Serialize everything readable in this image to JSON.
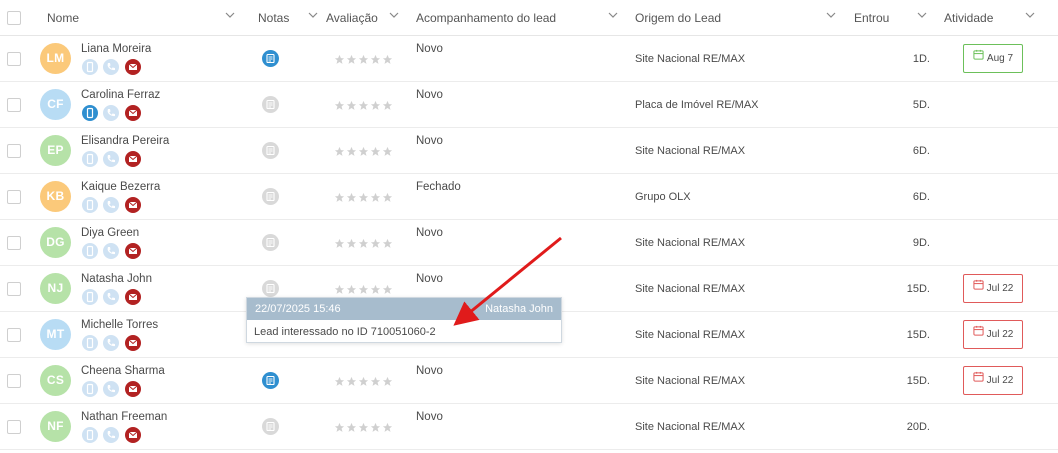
{
  "columns": {
    "nome": "Nome",
    "notas": "Notas",
    "avaliacao": "Avaliação",
    "acompanhamento": "Acompanhamento do lead",
    "origem": "Origem do Lead",
    "entrou": "Entrou",
    "atividade": "Atividade"
  },
  "colors": {
    "phone_active": "#2f8fd0",
    "phone_inactive": "#cfe2f3",
    "email": "#b22222",
    "note_active": "#2f8fd0",
    "note_inactive": "#d9d9d9",
    "star": "#d0d0d0",
    "activity_green": "#6cc05a",
    "activity_red": "#e05a5a"
  },
  "rows": [
    {
      "initials": "LM",
      "name": "Liana Moreira",
      "avatar_color": "#fbc97a",
      "mobile_active": false,
      "note_active": true,
      "rating": 0,
      "status": "Novo",
      "origin": "Site Nacional RE/MAX",
      "entrou": "1D.",
      "activity": {
        "label": "Aug 7",
        "color": "green"
      }
    },
    {
      "initials": "CF",
      "name": "Carolina Ferraz",
      "avatar_color": "#b8dcf4",
      "mobile_active": true,
      "note_active": false,
      "rating": 0,
      "status": "Novo",
      "origin": "Placa de Imóvel RE/MAX",
      "entrou": "5D.",
      "activity": null
    },
    {
      "initials": "EP",
      "name": "Elisandra Pereira",
      "avatar_color": "#b6e2a8",
      "mobile_active": false,
      "note_active": false,
      "rating": 0,
      "status": "Novo",
      "origin": "Site Nacional RE/MAX",
      "entrou": "6D.",
      "activity": null
    },
    {
      "initials": "KB",
      "name": "Kaique Bezerra",
      "avatar_color": "#fbc97a",
      "mobile_active": false,
      "note_active": false,
      "rating": 0,
      "status": "Fechado",
      "origin": "Grupo OLX",
      "entrou": "6D.",
      "activity": null
    },
    {
      "initials": "DG",
      "name": "Diya Green",
      "avatar_color": "#b6e2a8",
      "mobile_active": false,
      "note_active": false,
      "rating": 0,
      "status": "Novo",
      "origin": "Site Nacional RE/MAX",
      "entrou": "9D.",
      "activity": null
    },
    {
      "initials": "NJ",
      "name": "Natasha John",
      "avatar_color": "#b6e2a8",
      "mobile_active": false,
      "note_active": false,
      "rating": 0,
      "status": "Novo",
      "origin": "Site Nacional RE/MAX",
      "entrou": "15D.",
      "activity": {
        "label": "Jul 22",
        "color": "red"
      }
    },
    {
      "initials": "MT",
      "name": "Michelle Torres",
      "avatar_color": "#b8dcf4",
      "mobile_active": false,
      "note_active": false,
      "rating": 0,
      "status": "",
      "origin": "Site Nacional RE/MAX",
      "entrou": "15D.",
      "activity": {
        "label": "Jul 22",
        "color": "red"
      }
    },
    {
      "initials": "CS",
      "name": "Cheena Sharma",
      "avatar_color": "#b6e2a8",
      "mobile_active": false,
      "note_active": true,
      "rating": 0,
      "status": "Novo",
      "origin": "Site Nacional RE/MAX",
      "entrou": "15D.",
      "activity": {
        "label": "Jul 22",
        "color": "red"
      }
    },
    {
      "initials": "NF",
      "name": "Nathan Freeman",
      "avatar_color": "#b6e2a8",
      "mobile_active": false,
      "note_active": false,
      "rating": 0,
      "status": "Novo",
      "origin": "Site Nacional RE/MAX",
      "entrou": "20D.",
      "activity": null
    }
  ],
  "tooltip": {
    "date": "22/07/2025 15:46",
    "user": "Natasha John",
    "text": "Lead interessado no ID 710051060-2"
  }
}
